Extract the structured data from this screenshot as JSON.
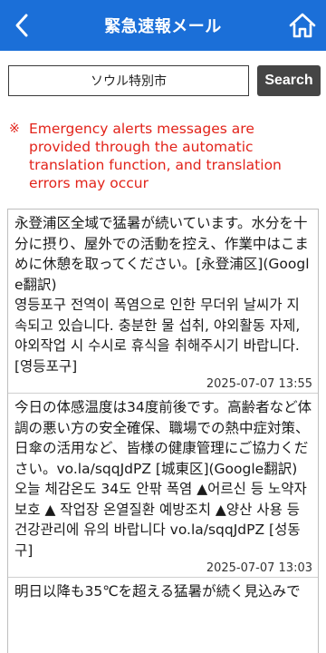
{
  "header": {
    "title": "緊急速報メール",
    "back_icon": "chevron-left-icon",
    "home_icon": "home-icon"
  },
  "search": {
    "value": "ソウル特別市",
    "button_label": "Search"
  },
  "notice": {
    "mark": "※",
    "text": "Emergency alerts messages are provided through the automatic translation function, and translation errors may occur"
  },
  "messages": [
    {
      "text": "永登浦区全域で猛暑が続いています。水分を十分に摂り、屋外での活動を控え、作業中はこまめに休憩を取ってください。[永登浦区](Google翻訳)\n영등포구 전역이 폭염으로 인한 무더위 날씨가 지속되고 있습니다. 충분한 물 섭취, 야외활동 자제, 야외작업 시 수시로 휴식을 취해주시기 바랍니다. [영등포구]",
      "time": "2025-07-07 13:55"
    },
    {
      "text": "今日の体感温度は34度前後です。高齢者など体調の悪い方の安全確保、職場での熱中症対策、日傘の活用など、皆様の健康管理にご協力ください。vo.la/sqqJdPZ [城東区](Google翻訳)\n오늘 체감온도 34도 안팎 폭염 ▲어르신 등 노약자 보호 ▲ 작업장 온열질환 예방조치 ▲양산 사용 등 건강관리에 유의 바랍니다 vo.la/sqqJdPZ [성동구]",
      "time": "2025-07-07 13:03"
    },
    {
      "text": "明日以降も35℃を超える猛暑が続く見込みで",
      "time": ""
    }
  ],
  "colors": {
    "header_bg": "#1b6fd8",
    "notice_text": "#e2231a",
    "search_button_bg": "#454545"
  }
}
